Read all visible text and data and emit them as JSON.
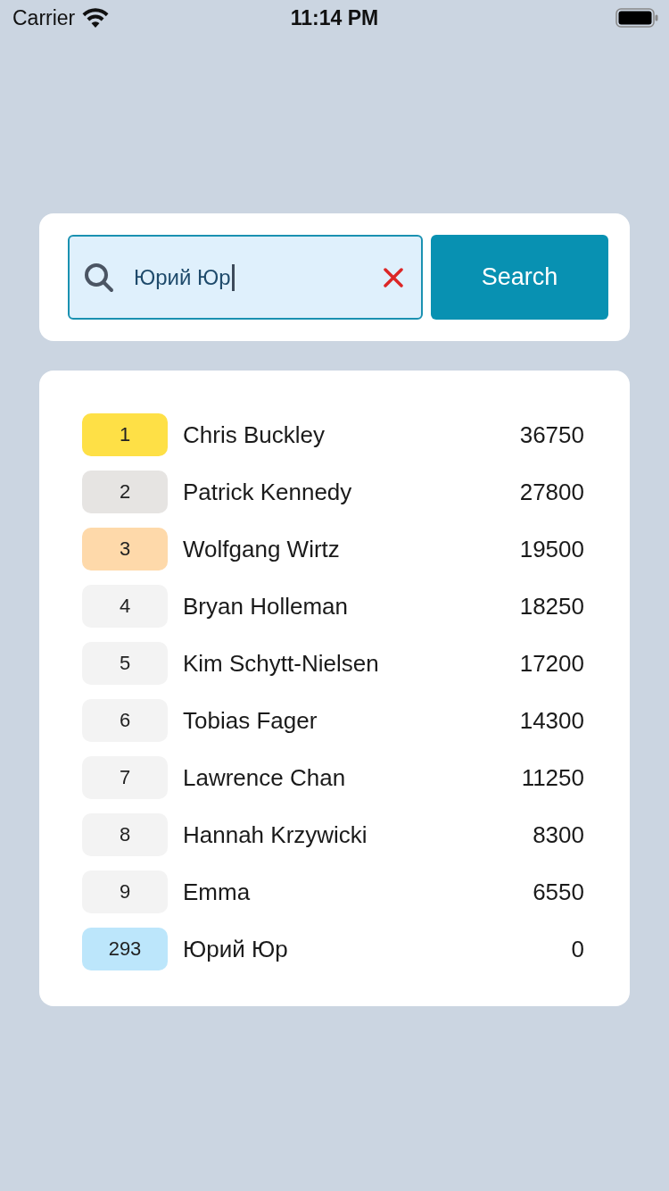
{
  "status_bar": {
    "carrier": "Carrier",
    "time": "11:14 PM"
  },
  "search": {
    "value": "Юрий Юр",
    "focused": true,
    "button": "Search"
  },
  "leaderboard": [
    {
      "rank": "1",
      "name": "Chris Buckley",
      "score": "36750",
      "color": "#fee046"
    },
    {
      "rank": "2",
      "name": "Patrick Kennedy",
      "score": "27800",
      "color": "#e6e4e2"
    },
    {
      "rank": "3",
      "name": "Wolfgang Wirtz",
      "score": "19500",
      "color": "#fed9aa"
    },
    {
      "rank": "4",
      "name": "Bryan Holleman",
      "score": "18250",
      "color": "#f3f3f3"
    },
    {
      "rank": "5",
      "name": "Kim Schytt-Nielsen",
      "score": "17200",
      "color": "#f3f3f3"
    },
    {
      "rank": "6",
      "name": "Tobias Fager",
      "score": "14300",
      "color": "#f3f3f3"
    },
    {
      "rank": "7",
      "name": "Lawrence Chan",
      "score": "11250",
      "color": "#f3f3f3"
    },
    {
      "rank": "8",
      "name": "Hannah Krzywicki",
      "score": "8300",
      "color": "#f3f3f3"
    },
    {
      "rank": "9",
      "name": "Emma",
      "score": "6550",
      "color": "#f3f3f3"
    },
    {
      "rank": "293",
      "name": "Юрий Юр",
      "score": "0",
      "color": "#bce6fb"
    }
  ]
}
